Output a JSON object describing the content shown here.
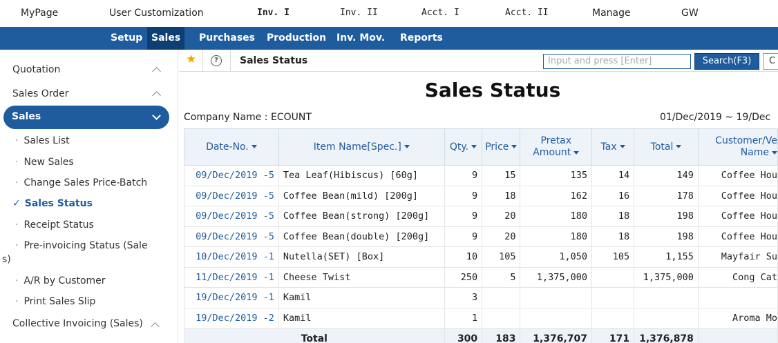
{
  "top_nav": [
    "MyPage",
    "User Customization",
    "Inv. I",
    "Inv. II",
    "Acct. I",
    "Acct. II",
    "Manage",
    "GW"
  ],
  "sub_nav": [
    "Setup",
    "Sales",
    "Purchases",
    "Production",
    "Inv. Mov.",
    "Reports"
  ],
  "sidebar": {
    "sections": {
      "quotation": "Quotation",
      "sales_order": "Sales Order",
      "sales": "Sales",
      "collective": "Collective Invoicing (Sales)"
    },
    "items": [
      "Sales List",
      "New Sales",
      "Change Sales Price-Batch",
      "Sales Status",
      "Receipt Status",
      "Pre-invoicing Status (Sale",
      "s)",
      "A/R by Customer",
      "Print Sales Slip"
    ]
  },
  "toolbar": {
    "title": "Sales Status",
    "search_placeholder": "Input and press [Enter]",
    "search_button": "Search(F3)",
    "second_button": "C",
    "help_glyph": "?"
  },
  "report": {
    "title": "Sales Status",
    "company": "Company Name : ECOUNT",
    "period": "01/Dec/2019 ~ 19/Dec"
  },
  "table": {
    "headers": [
      "Date-No.",
      "Item Name[Spec.]",
      "Qty.",
      "Price",
      "Pretax Amount",
      "Tax",
      "Total",
      "Customer/Ve Name"
    ],
    "header_pretax_1": "Pretax",
    "header_pretax_2": "Amount",
    "header_cust_1": "Customer/Ve",
    "header_cust_2": "Name",
    "rows": [
      [
        "09/Dec/2019 -5",
        "Tea Leaf(Hibiscus) [60g]",
        "9",
        "15",
        "135",
        "14",
        "149",
        "Coffee Hou"
      ],
      [
        "09/Dec/2019 -5",
        "Coffee Bean(mild) [200g]",
        "9",
        "18",
        "162",
        "16",
        "178",
        "Coffee Hou"
      ],
      [
        "09/Dec/2019 -5",
        "Coffee Bean(strong) [200g]",
        "9",
        "20",
        "180",
        "18",
        "198",
        "Coffee Hou"
      ],
      [
        "09/Dec/2019 -5",
        "Coffee Bean(double) [200g]",
        "9",
        "20",
        "180",
        "18",
        "198",
        "Coffee Hou"
      ],
      [
        "10/Dec/2019 -1",
        "Nutella(SET) [Box]",
        "10",
        "105",
        "1,050",
        "105",
        "1,155",
        "Mayfair Su"
      ],
      [
        "11/Dec/2019 -1",
        "Cheese Twist",
        "250",
        "5",
        "1,375,000",
        "",
        "1,375,000",
        "Cong Cat"
      ],
      [
        "19/Dec/2019 -1",
        "Kamil",
        "3",
        "",
        "",
        "",
        "",
        ""
      ],
      [
        "19/Dec/2019 -2",
        "Kamil",
        "1",
        "",
        "",
        "",
        "",
        "Aroma Mo"
      ]
    ],
    "total": {
      "label": "Total",
      "qty": "300",
      "price": "183",
      "pretax": "1,376,707",
      "tax": "171",
      "total": "1,376,878"
    }
  }
}
